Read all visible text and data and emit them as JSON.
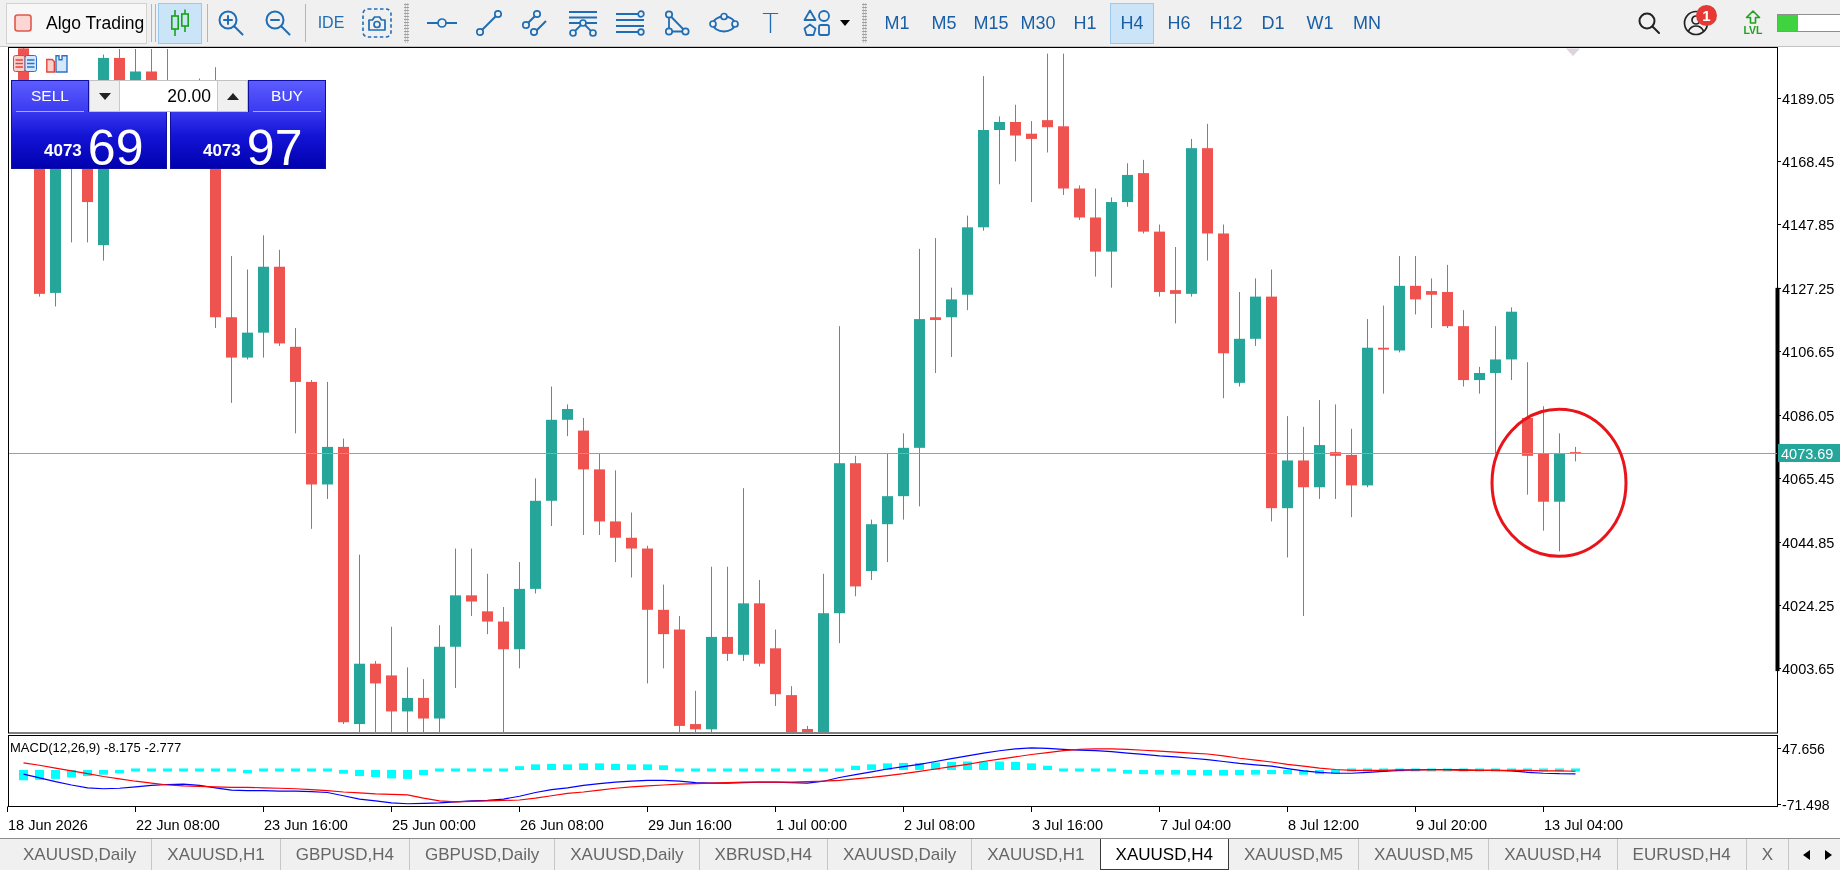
{
  "toolbar": {
    "algo_trading": {
      "label": "Algo Trading",
      "enabled": false
    },
    "chart_types": [
      {
        "kind": "candlesticks",
        "selected": true
      }
    ],
    "zoom": [
      {
        "kind": "zoom-in"
      },
      {
        "kind": "zoom-out"
      }
    ],
    "utilities": [
      {
        "kind": "ide",
        "label": "IDE"
      },
      {
        "kind": "screenshot"
      }
    ],
    "drawing_tools": [
      {
        "kind": "horizontal-line"
      },
      {
        "kind": "trend-line"
      },
      {
        "kind": "channel"
      },
      {
        "kind": "fan"
      },
      {
        "kind": "levels"
      },
      {
        "kind": "triangle"
      },
      {
        "kind": "ellipse"
      },
      {
        "kind": "text",
        "label": "T"
      },
      {
        "kind": "shapes"
      }
    ],
    "timeframes": [
      {
        "label": "M1",
        "selected": false
      },
      {
        "label": "M5",
        "selected": false
      },
      {
        "label": "M15",
        "selected": false
      },
      {
        "label": "M30",
        "selected": false
      },
      {
        "label": "H1",
        "selected": false
      },
      {
        "label": "H4",
        "selected": true
      },
      {
        "label": "H6",
        "selected": false
      },
      {
        "label": "H12",
        "selected": false
      },
      {
        "label": "D1",
        "selected": false
      },
      {
        "label": "W1",
        "selected": false
      },
      {
        "label": "MN",
        "selected": false
      }
    ],
    "right_tools": [
      {
        "kind": "search"
      },
      {
        "kind": "account",
        "badge": "1"
      },
      {
        "kind": "level",
        "label": "LVL"
      }
    ],
    "level_meter": {
      "level": 0.32
    }
  },
  "chart": {
    "trade_panel": {
      "sell": {
        "label": "SELL",
        "big_figure": "4073",
        "pips": "69"
      },
      "volume": "20.00",
      "buy": {
        "label": "BUY",
        "big_figure": "4073",
        "pips": "97"
      }
    },
    "price_scale": [
      "4189.05",
      "4168.45",
      "4147.85",
      "4127.25",
      "4106.65",
      "4086.05",
      "4065.45",
      "4044.85",
      "4024.25",
      "4003.65"
    ],
    "current_price": "4073.69",
    "indicator": {
      "label": "MACD(12,26,9) -8.175 -2.777",
      "scale": [
        "47.656",
        "-71.498"
      ]
    },
    "time_scale": [
      "18 Jun 2026",
      "22 Jun 08:00",
      "23 Jun 16:00",
      "25 Jun 00:00",
      "26 Jun 08:00",
      "29 Jun 16:00",
      "1 Jul 00:00",
      "2 Jul 08:00",
      "3 Jul 16:00",
      "7 Jul 04:00",
      "8 Jul 12:00",
      "9 Jul 20:00",
      "13 Jul 04:00"
    ]
  },
  "tabs": [
    {
      "label": "XAUUSD,Daily",
      "selected": false
    },
    {
      "label": "XAUUSD,H1",
      "selected": false
    },
    {
      "label": "GBPUSD,H4",
      "selected": false
    },
    {
      "label": "GBPUSD,Daily",
      "selected": false
    },
    {
      "label": "XAUUSD,Daily",
      "selected": false
    },
    {
      "label": "XBRUSD,H4",
      "selected": false
    },
    {
      "label": "XAUUSD,Daily",
      "selected": false
    },
    {
      "label": "XAUUSD,H1",
      "selected": false
    },
    {
      "label": "XAUUSD,H4",
      "selected": true
    },
    {
      "label": "XAUUSD,M5",
      "selected": false
    },
    {
      "label": "XAUUSD,M5",
      "selected": false
    },
    {
      "label": "XAUUSD,H4",
      "selected": false
    },
    {
      "label": "EURUSD,H4",
      "selected": false
    },
    {
      "label": "X",
      "selected": false
    }
  ]
}
